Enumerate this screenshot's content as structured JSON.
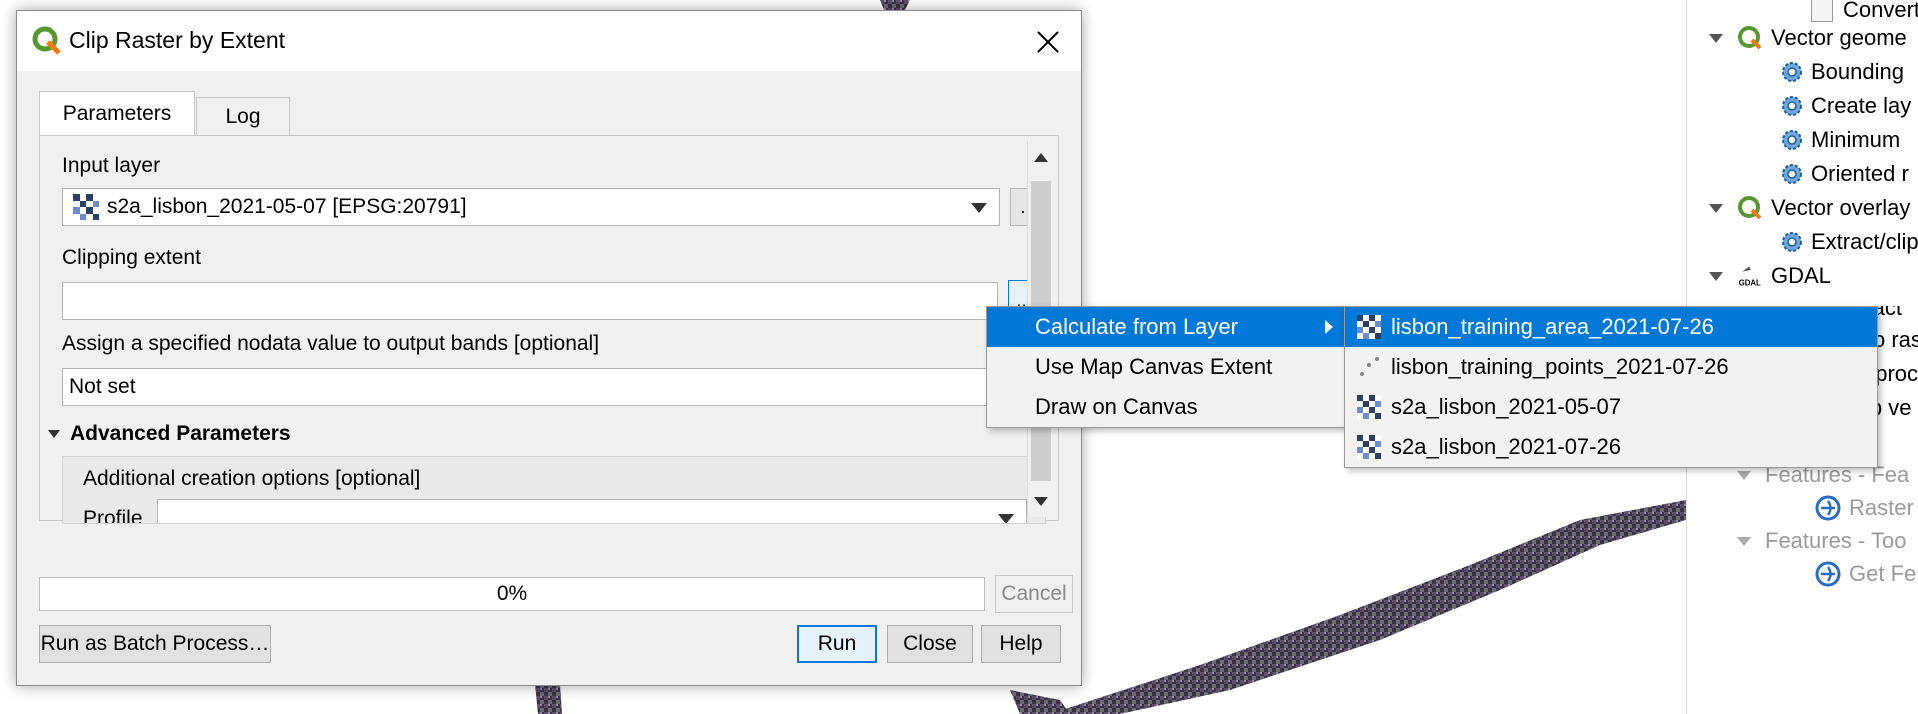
{
  "dialog": {
    "title": "Clip Raster by Extent",
    "tabs": [
      "Parameters",
      "Log"
    ],
    "input_layer_label": "Input layer",
    "input_layer_value": "s2a_lisbon_2021-05-07 [EPSG:20791]",
    "browse_label": "...",
    "clipping_extent_label": "Clipping extent",
    "clipping_extent_value": "",
    "nodata_label": "Assign a specified nodata value to output bands [optional]",
    "nodata_value": "Not set",
    "advanced_label": "Advanced Parameters",
    "creation_options_label": "Additional creation options [optional]",
    "profile_label": "Profile",
    "profile_value": "",
    "progress_text": "0%",
    "progress": 0,
    "buttons": {
      "cancel": "Cancel",
      "batch": "Run as Batch Process…",
      "run": "Run",
      "close": "Close",
      "help": "Help"
    }
  },
  "extent_menu": {
    "items": [
      "Calculate from Layer",
      "Use Map Canvas Extent",
      "Draw on Canvas"
    ],
    "selected": "Calculate from Layer"
  },
  "layer_menu": {
    "items": [
      {
        "label": "lisbon_training_area_2021-07-26",
        "icon": "raster-layer-icon"
      },
      {
        "label": "lisbon_training_points_2021-07-26",
        "icon": "point-layer-icon"
      },
      {
        "label": "s2a_lisbon_2021-05-07",
        "icon": "raster-layer-icon"
      },
      {
        "label": "s2a_lisbon_2021-07-26",
        "icon": "raster-layer-icon"
      }
    ],
    "selected": "lisbon_training_area_2021-07-26"
  },
  "toolbox": {
    "items": [
      {
        "label": "Convert la",
        "type": "tool"
      },
      {
        "label": "Vector geome",
        "type": "group"
      },
      {
        "label": "Bounding",
        "type": "gear"
      },
      {
        "label": "Create lay",
        "type": "gear"
      },
      {
        "label": "Minimum",
        "type": "gear"
      },
      {
        "label": "Oriented r",
        "type": "gear"
      },
      {
        "label": "Vector overlay",
        "type": "group"
      },
      {
        "label": "Extract/clip",
        "type": "gear"
      },
      {
        "label": "GDAL",
        "type": "gdal"
      },
      {
        "label": "Raster extract",
        "type": "group"
      },
      {
        "label": "o ras",
        "type": "partial"
      },
      {
        "label": "oproc",
        "type": "partial"
      },
      {
        "label": "ip ve",
        "type": "partial"
      },
      {
        "label": "Features - Fea",
        "type": "group-grey"
      },
      {
        "label": "Raster",
        "type": "plugin-grey"
      },
      {
        "label": "Features - Too",
        "type": "group-grey"
      },
      {
        "label": "Get Fe",
        "type": "plugin-grey"
      }
    ]
  },
  "colors": {
    "accent": "#0078d7",
    "qgis_green": "#589632",
    "qgis_yellow": "#ee7913"
  }
}
